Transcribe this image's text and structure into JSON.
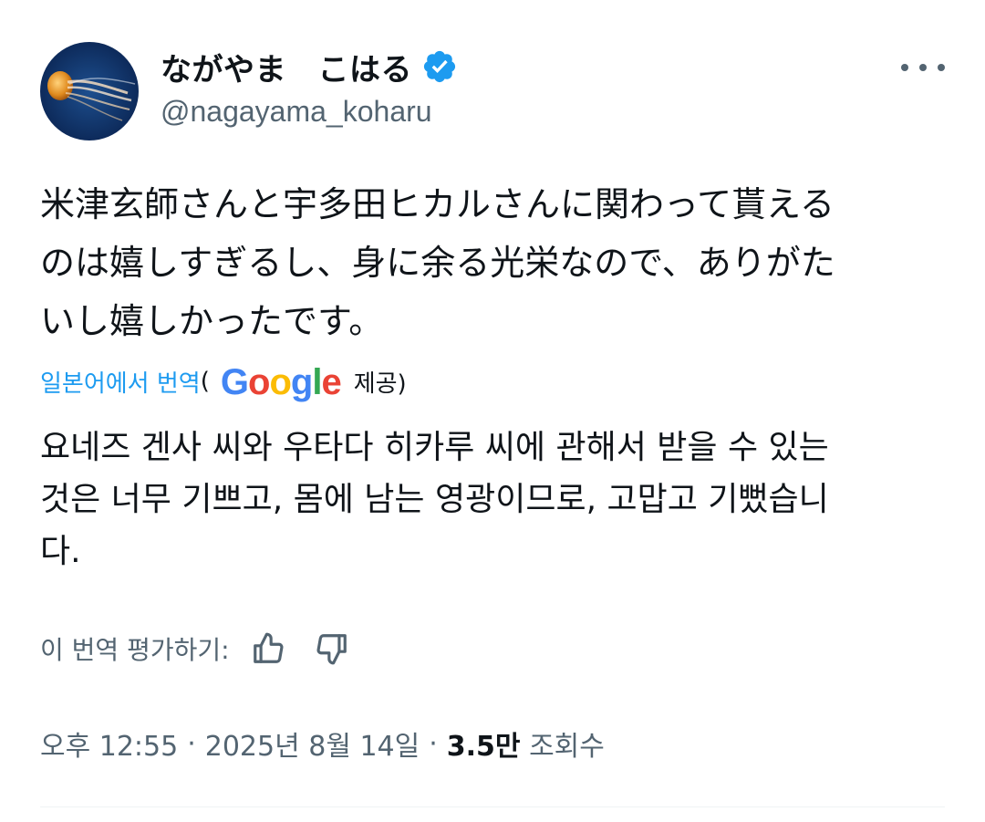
{
  "author": {
    "display_name": "ながやま　こはる",
    "handle": "@nagayama_koharu",
    "verified": true,
    "avatar_icon": "jellyfish-avatar"
  },
  "tweet": {
    "lines": [
      "米津玄師さんと宇多田ヒカルさんに関わって貰える",
      "のは嬉しすぎるし、身に余る光栄なので、ありがた",
      "いし嬉しかったです。"
    ]
  },
  "translation": {
    "link_label": "일본어에서 번역",
    "paren_open": "(",
    "provider": "Google",
    "provided_label": "제공)",
    "lines": [
      "요네즈 겐사 씨와 우타다 히카루 씨에 관해서 받을 수 있는",
      "것은 너무 기쁘고, 몸에 남는 영광이므로, 고맙고 기뻤습니",
      "다."
    ],
    "rate_label": "이 번역 평가하기:"
  },
  "meta": {
    "time": "오후 12:55",
    "separator": "·",
    "date": "2025년 8월 14일",
    "views_count": "3.5만",
    "views_label": "조회수"
  },
  "colors": {
    "link": "#1d9bf0",
    "secondary_text": "#536471",
    "primary_text": "#0f1419",
    "verified_badge": "#1d9bf0"
  }
}
